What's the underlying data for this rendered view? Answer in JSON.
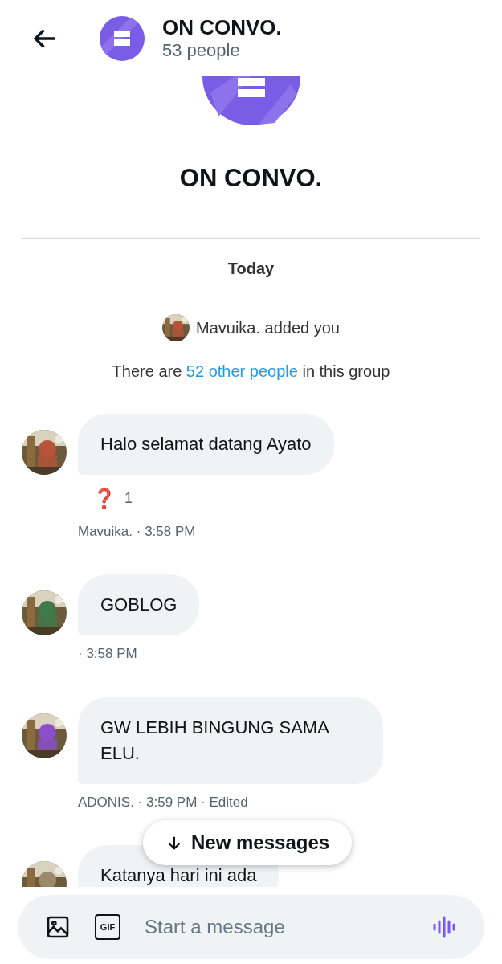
{
  "header": {
    "title": "ON CONVO.",
    "subtitle": "53 people"
  },
  "group": {
    "name": "ON CONVO."
  },
  "day_label": "Today",
  "added_notice": "Mavuika. added you",
  "member_notice": {
    "before": "There are ",
    "link": "52 other people",
    "after": " in this group"
  },
  "messages": [
    {
      "text": "Halo selamat datang Ayato",
      "reaction": {
        "emoji": "❓",
        "count": "1"
      },
      "meta": "Mavuika. · 3:58 PM"
    },
    {
      "text": "GOBLOG",
      "meta": "· 3:58 PM"
    },
    {
      "text": "GW LEBIH BINGUNG SAMA ELU.",
      "meta": "ADONIS. · 3:59 PM · Edited"
    },
    {
      "text": "Katanya hari ini ada"
    }
  ],
  "new_messages_button": "New messages",
  "composer": {
    "placeholder": "Start a message",
    "gif_label": "GIF"
  }
}
